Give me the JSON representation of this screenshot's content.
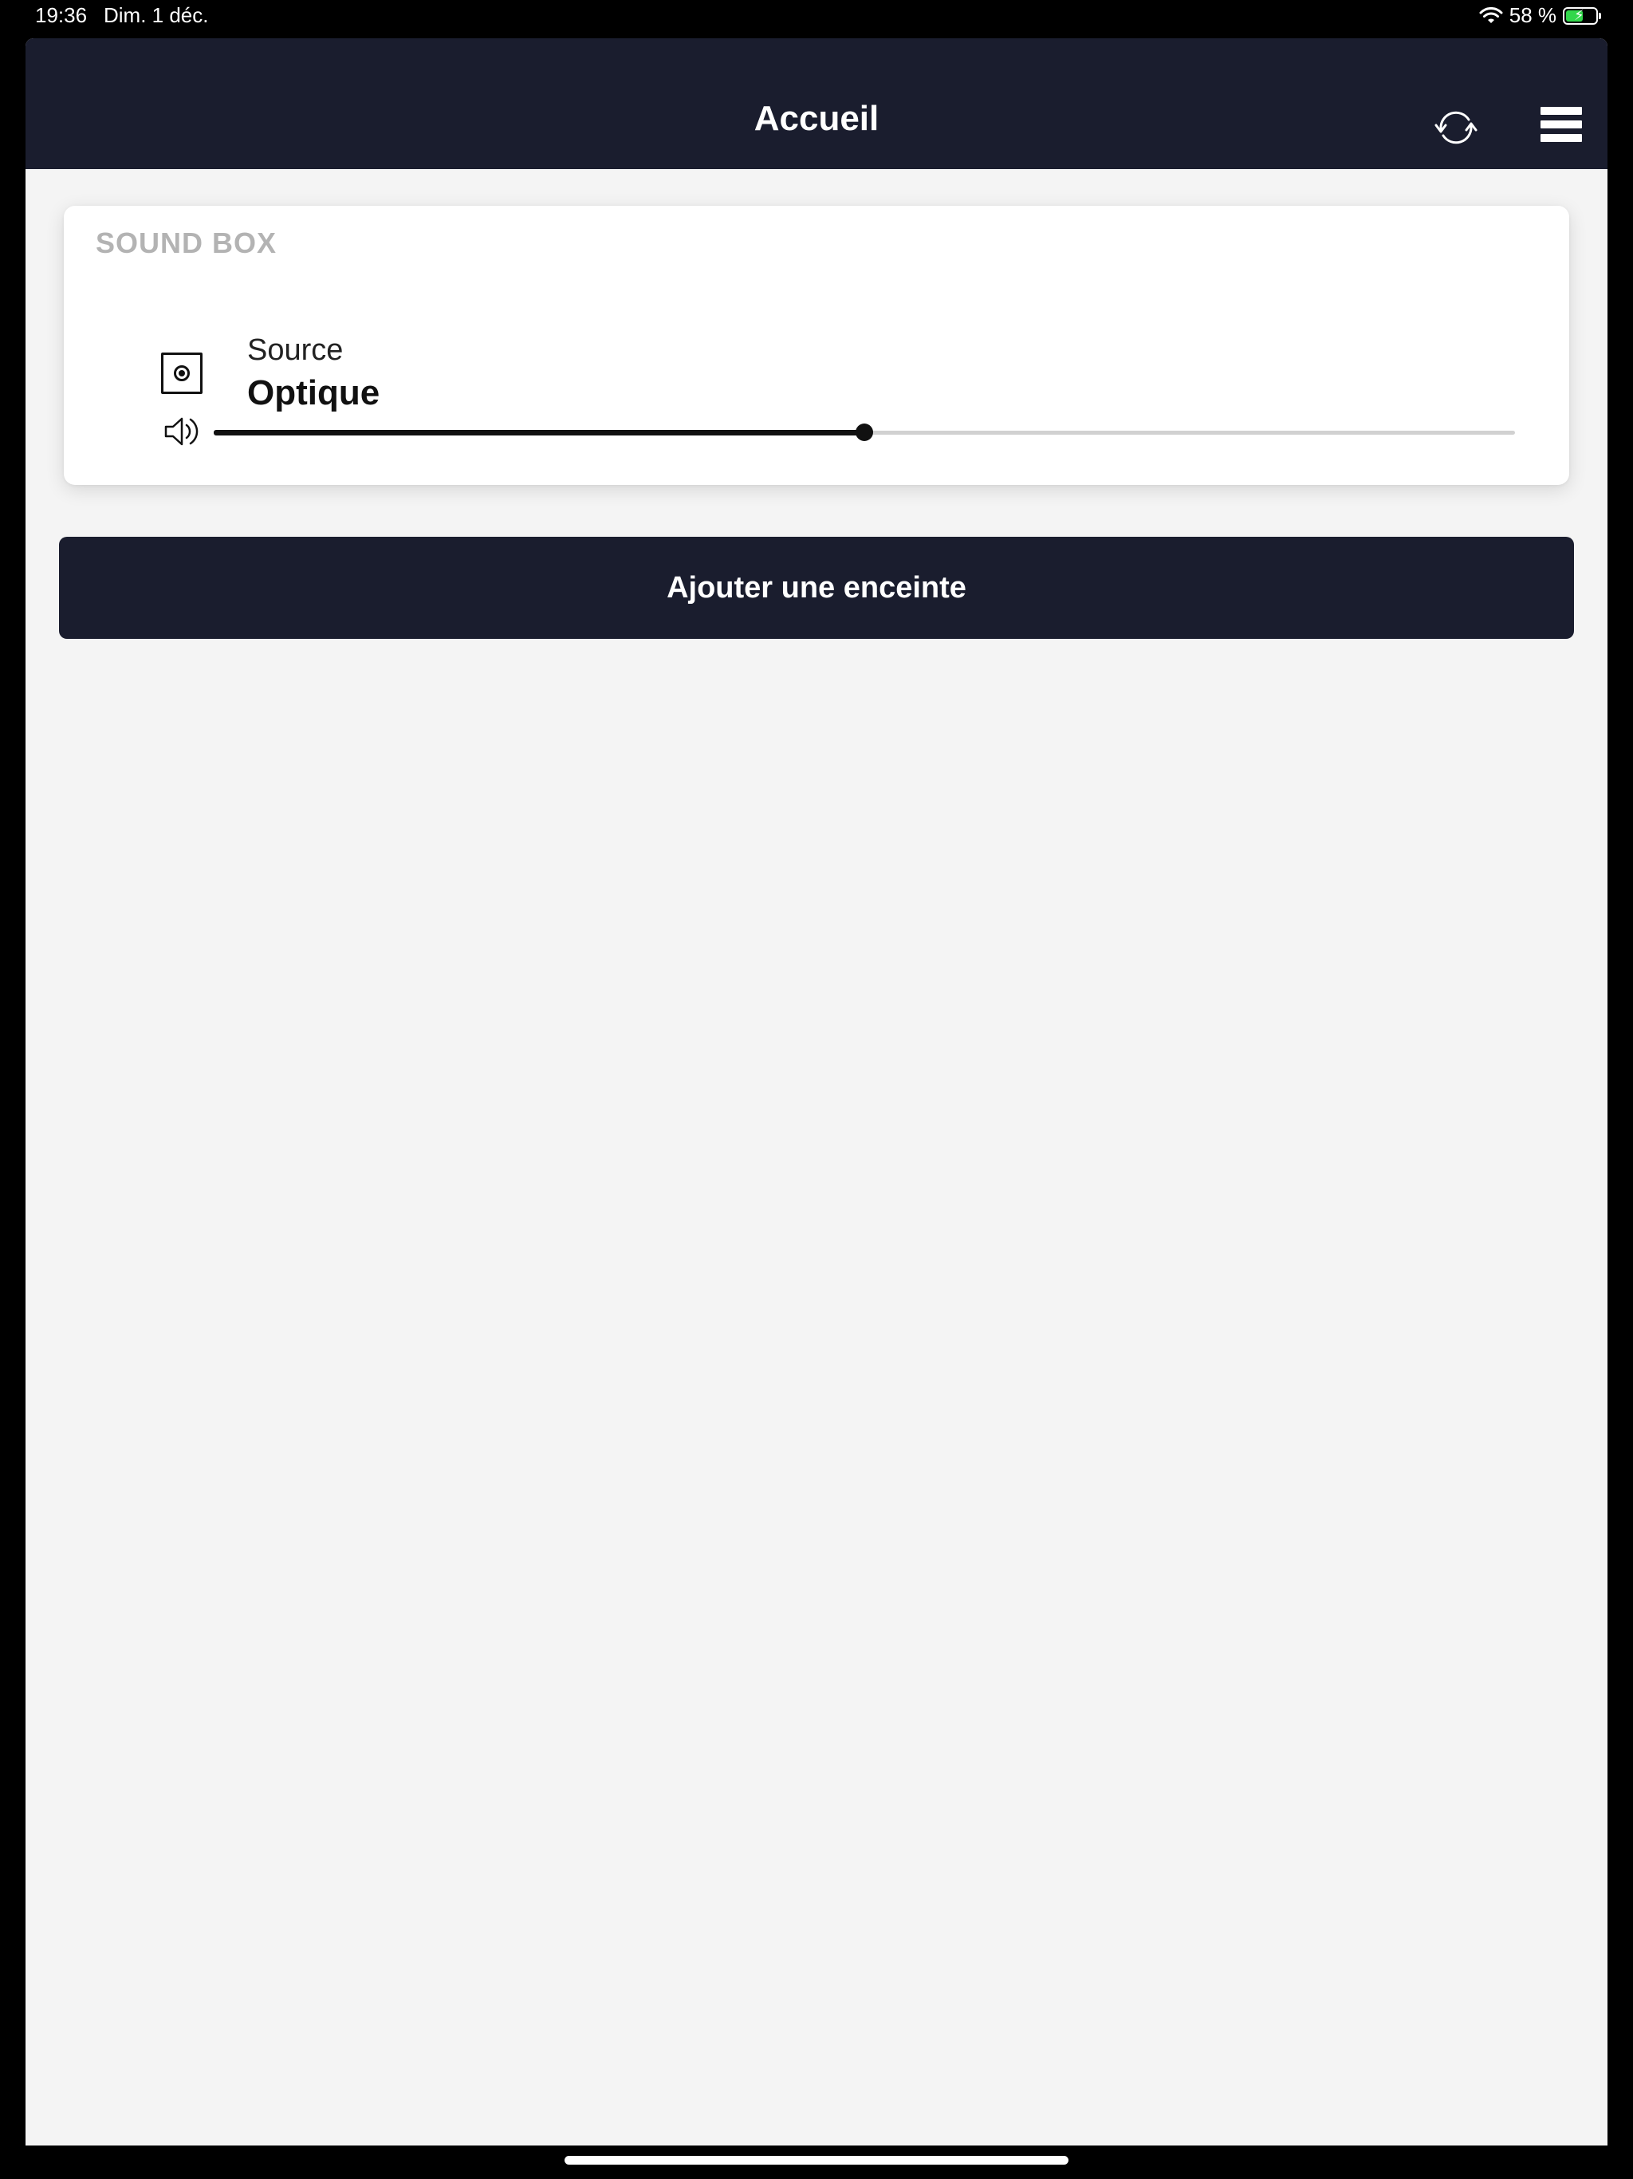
{
  "status_bar": {
    "time": "19:36",
    "date": "Dim. 1 déc.",
    "battery_percent": "58 %",
    "battery_level": 0.58,
    "battery_color": "#32d74b"
  },
  "header": {
    "title": "Accueil",
    "sync_icon": "sync-icon",
    "menu_icon": "hamburger-menu-icon",
    "background": "#1a1d2e"
  },
  "speaker": {
    "name": "SOUND BOX",
    "source_label": "Source",
    "source_value": "Optique",
    "source_icon": "optical-input-icon",
    "volume_icon": "speaker-volume-icon",
    "volume_level": 0.5
  },
  "actions": {
    "add_speaker_label": "Ajouter une enceinte"
  }
}
